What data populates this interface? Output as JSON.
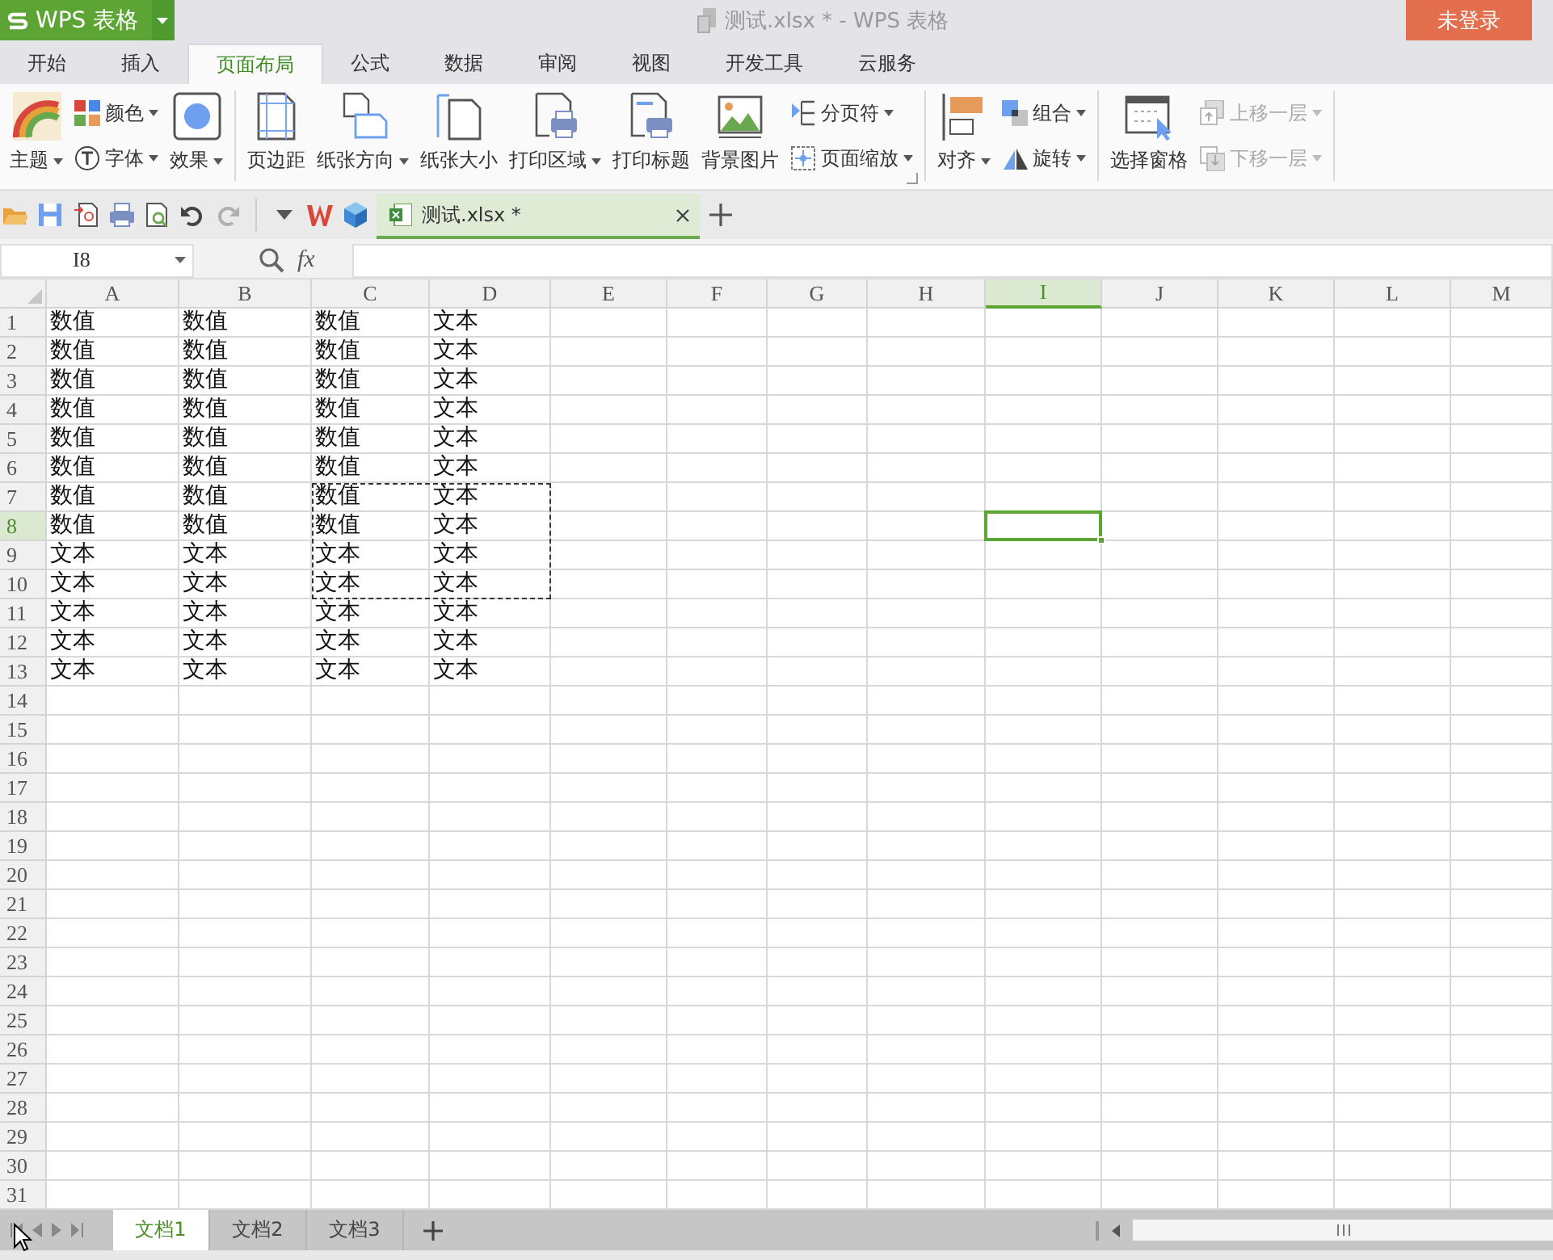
{
  "title_bar": {
    "app_button": "WPS 表格",
    "title": "测试.xlsx * - WPS 表格",
    "login_button": "未登录"
  },
  "menu_tabs": [
    {
      "label": "开始",
      "selected": false
    },
    {
      "label": "插入",
      "selected": false
    },
    {
      "label": "页面布局",
      "selected": true
    },
    {
      "label": "公式",
      "selected": false
    },
    {
      "label": "数据",
      "selected": false
    },
    {
      "label": "审阅",
      "selected": false
    },
    {
      "label": "视图",
      "selected": false
    },
    {
      "label": "开发工具",
      "selected": false
    },
    {
      "label": "云服务",
      "selected": false
    }
  ],
  "ribbon": {
    "groups": [
      {
        "columns": [
          {
            "kind": "large",
            "label": "主题",
            "dropdown": true,
            "disabled": false
          },
          {
            "kind": "stack",
            "buttons": [
              {
                "label": "颜色",
                "dropdown": true,
                "disabled": false
              },
              {
                "label": "字体",
                "dropdown": true,
                "disabled": false
              }
            ]
          },
          {
            "kind": "large",
            "label": "效果",
            "dropdown": true,
            "disabled": false
          }
        ]
      },
      {
        "launcher": true,
        "columns": [
          {
            "kind": "large",
            "label": "页边距",
            "dropdown": false,
            "disabled": false
          },
          {
            "kind": "large",
            "label": "纸张方向",
            "dropdown": true,
            "disabled": false
          },
          {
            "kind": "large",
            "label": "纸张大小",
            "dropdown": false,
            "disabled": false
          },
          {
            "kind": "large",
            "label": "打印区域",
            "dropdown": true,
            "disabled": false
          },
          {
            "kind": "large",
            "label": "打印标题",
            "dropdown": false,
            "disabled": false
          },
          {
            "kind": "large",
            "label": "背景图片",
            "dropdown": false,
            "disabled": false
          },
          {
            "kind": "stack",
            "buttons": [
              {
                "label": "分页符",
                "dropdown": true,
                "disabled": false
              },
              {
                "label": "页面缩放",
                "dropdown": true,
                "disabled": false
              }
            ]
          }
        ]
      },
      {
        "columns": [
          {
            "kind": "large",
            "label": "对齐",
            "dropdown": true,
            "disabled": false
          },
          {
            "kind": "stack",
            "buttons": [
              {
                "label": "组合",
                "dropdown": true,
                "disabled": false
              },
              {
                "label": "旋转",
                "dropdown": true,
                "disabled": false
              }
            ]
          }
        ]
      },
      {
        "columns": [
          {
            "kind": "large",
            "label": "选择窗格",
            "dropdown": false,
            "disabled": false
          },
          {
            "kind": "stack",
            "buttons": [
              {
                "label": "上移一层",
                "dropdown": true,
                "disabled": true
              },
              {
                "label": "下移一层",
                "dropdown": true,
                "disabled": true
              }
            ]
          }
        ]
      }
    ]
  },
  "quick_toolbar": [
    {
      "disabled": false
    },
    {
      "disabled": false
    },
    {
      "disabled": false
    },
    {
      "disabled": false
    },
    {
      "disabled": false
    },
    {
      "disabled": false
    },
    {
      "disabled": true
    }
  ],
  "document_tab": {
    "label": "测试.xlsx *",
    "selected": true
  },
  "formula_bar": {
    "name_box": "I8",
    "fx_label": "fx"
  },
  "sheet": {
    "columns": [
      {
        "label": "A",
        "selected": false,
        "in_copy_range": false
      },
      {
        "label": "B",
        "selected": false,
        "in_copy_range": false
      },
      {
        "label": "C",
        "selected": false,
        "in_copy_range": true
      },
      {
        "label": "D",
        "selected": false,
        "in_copy_range": true
      },
      {
        "label": "E",
        "selected": false,
        "in_copy_range": false
      },
      {
        "label": "F",
        "selected": false,
        "in_copy_range": false
      },
      {
        "label": "G",
        "selected": false,
        "in_copy_range": false
      },
      {
        "label": "H",
        "selected": false,
        "in_copy_range": false
      },
      {
        "label": "I",
        "selected": true,
        "in_copy_range": false
      },
      {
        "label": "J",
        "selected": false,
        "in_copy_range": false
      },
      {
        "label": "K",
        "selected": false,
        "in_copy_range": false
      },
      {
        "label": "L",
        "selected": false,
        "in_copy_range": false
      },
      {
        "label": "M",
        "selected": false,
        "in_copy_range": false
      }
    ],
    "rows": [
      {
        "number": "1",
        "selected": false,
        "in_copy_range": false,
        "cells": [
          "数值",
          "数值",
          "数值",
          "文本"
        ]
      },
      {
        "number": "2",
        "selected": false,
        "in_copy_range": false,
        "cells": [
          "数值",
          "数值",
          "数值",
          "文本"
        ]
      },
      {
        "number": "3",
        "selected": false,
        "in_copy_range": false,
        "cells": [
          "数值",
          "数值",
          "数值",
          "文本"
        ]
      },
      {
        "number": "4",
        "selected": false,
        "in_copy_range": false,
        "cells": [
          "数值",
          "数值",
          "数值",
          "文本"
        ]
      },
      {
        "number": "5",
        "selected": false,
        "in_copy_range": false,
        "cells": [
          "数值",
          "数值",
          "数值",
          "文本"
        ]
      },
      {
        "number": "6",
        "selected": false,
        "in_copy_range": false,
        "cells": [
          "数值",
          "数值",
          "数值",
          "文本"
        ]
      },
      {
        "number": "7",
        "selected": false,
        "in_copy_range": true,
        "cells": [
          "数值",
          "数值",
          "数值",
          "文本"
        ]
      },
      {
        "number": "8",
        "selected": true,
        "in_copy_range": true,
        "cells": [
          "数值",
          "数值",
          "数值",
          "文本"
        ]
      },
      {
        "number": "9",
        "selected": false,
        "in_copy_range": true,
        "cells": [
          "文本",
          "文本",
          "文本",
          "文本"
        ]
      },
      {
        "number": "10",
        "selected": false,
        "in_copy_range": true,
        "cells": [
          "文本",
          "文本",
          "文本",
          "文本"
        ]
      },
      {
        "number": "11",
        "selected": false,
        "in_copy_range": false,
        "cells": [
          "文本",
          "文本",
          "文本",
          "文本"
        ]
      },
      {
        "number": "12",
        "selected": false,
        "in_copy_range": false,
        "cells": [
          "文本",
          "文本",
          "文本",
          "文本"
        ]
      },
      {
        "number": "13",
        "selected": false,
        "in_copy_range": false,
        "cells": [
          "文本",
          "文本",
          "文本",
          "文本"
        ]
      },
      {
        "number": "14",
        "selected": false,
        "in_copy_range": false
      },
      {
        "number": "15",
        "selected": false,
        "in_copy_range": false
      },
      {
        "number": "16",
        "selected": false,
        "in_copy_range": false
      },
      {
        "number": "17",
        "selected": false,
        "in_copy_range": false
      },
      {
        "number": "18",
        "selected": false,
        "in_copy_range": false
      },
      {
        "number": "19",
        "selected": false,
        "in_copy_range": false
      },
      {
        "number": "20",
        "selected": false,
        "in_copy_range": false
      },
      {
        "number": "21",
        "selected": false,
        "in_copy_range": false
      },
      {
        "number": "22",
        "selected": false,
        "in_copy_range": false
      },
      {
        "number": "23",
        "selected": false,
        "in_copy_range": false
      },
      {
        "number": "24",
        "selected": false,
        "in_copy_range": false
      },
      {
        "number": "25",
        "selected": false,
        "in_copy_range": false
      },
      {
        "number": "26",
        "selected": false,
        "in_copy_range": false
      },
      {
        "number": "27",
        "selected": false,
        "in_copy_range": false
      },
      {
        "number": "28",
        "selected": false,
        "in_copy_range": false
      },
      {
        "number": "29",
        "selected": false,
        "in_copy_range": false
      },
      {
        "number": "30",
        "selected": false,
        "in_copy_range": false
      },
      {
        "number": "31",
        "selected": false,
        "in_copy_range": false
      }
    ]
  },
  "sheet_tabs": [
    {
      "label": "文档1",
      "selected": true
    },
    {
      "label": "文档2",
      "selected": false
    },
    {
      "label": "文档3",
      "selected": false
    }
  ]
}
